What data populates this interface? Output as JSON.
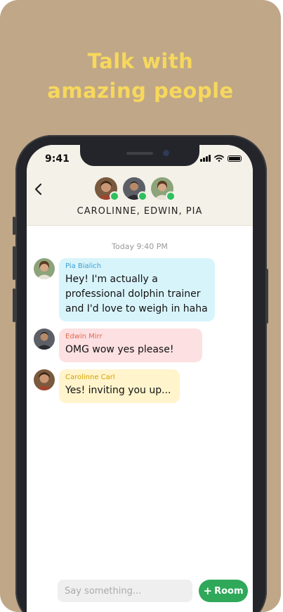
{
  "promo": {
    "headline_line1": "Talk with",
    "headline_line2": "amazing people",
    "colors": {
      "background": "#c0a788",
      "headline": "#f6d85c"
    }
  },
  "status_bar": {
    "time": "9:41"
  },
  "room": {
    "title": "CAROLINNE, EDWIN, PIA",
    "participants": [
      {
        "name": "Carolinne",
        "online": true
      },
      {
        "name": "Edwin",
        "online": true
      },
      {
        "name": "Pia",
        "online": true
      }
    ]
  },
  "chat": {
    "timestamp_day": "Today",
    "timestamp_time": "9:40 PM",
    "messages": [
      {
        "sender": "Pia Bialich",
        "text": "Hey! I'm actually a professional dolphin trainer and I'd love to weigh in haha",
        "bubble_color": "#d8f4fb",
        "sender_color": "#3a9fcf"
      },
      {
        "sender": "Edwin Mirr",
        "text": "OMG wow yes please!",
        "bubble_color": "#fde0e2",
        "sender_color": "#e36a4f"
      },
      {
        "sender": "Carolinne Carl",
        "text": "Yes! inviting you up...",
        "bubble_color": "#fff4cc",
        "sender_color": "#d4a200"
      }
    ]
  },
  "composer": {
    "placeholder": "Say something...",
    "room_button_label": "Room",
    "room_button_icon": "plus-icon",
    "accent": "#2fa85a"
  }
}
